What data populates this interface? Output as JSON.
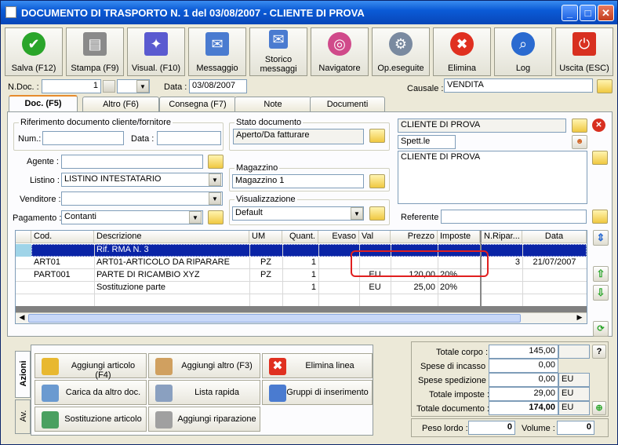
{
  "window": {
    "title": "DOCUMENTO DI TRASPORTO N. 1   del 03/08/2007 - CLIENTE DI PROVA"
  },
  "toolbar": [
    {
      "label": "Salva (F12)",
      "icon": "check-icon",
      "color": "#2aa52a"
    },
    {
      "label": "Stampa (F9)",
      "icon": "printer-icon",
      "color": "#8a8a8a"
    },
    {
      "label": "Visual. (F10)",
      "icon": "magic-wand-icon",
      "color": "#5a5ad0"
    },
    {
      "label": "Messaggio",
      "icon": "envelope-pen-icon",
      "color": "#4a7bd0"
    },
    {
      "label": "Storico messaggi",
      "icon": "search-mail-icon",
      "color": "#4a7bd0"
    },
    {
      "label": "Navigatore",
      "icon": "compass-icon",
      "color": "#d04a8a"
    },
    {
      "label": "Op.eseguite",
      "icon": "gears-icon",
      "color": "#7a8aa0"
    },
    {
      "label": "Elimina",
      "icon": "delete-x-icon",
      "color": "#e03020"
    },
    {
      "label": "Log",
      "icon": "magnifier-book-icon",
      "color": "#2a6ad0"
    },
    {
      "label": "Uscita (ESC)",
      "icon": "exit-icon",
      "color": "#d83020"
    }
  ],
  "header": {
    "ndoc_label": "N.Doc. :",
    "ndoc_value": "1",
    "data_label": "Data :",
    "data_value": "03/08/2007",
    "causale_label": "Causale :",
    "causale_value": "VENDITA"
  },
  "tabs": [
    "Doc. (F5)",
    "Altro (F6)",
    "Consegna (F7)",
    "Note",
    "Documenti"
  ],
  "doc": {
    "rif_title": "Riferimento documento cliente/fornitore",
    "num_label": "Num.:",
    "data_label": "Data :",
    "stato_title": "Stato documento",
    "stato_value": "Aperto/Da fatturare",
    "agente_label": "Agente :",
    "listino_label": "Listino :",
    "listino_value": "LISTINO INTESTATARIO",
    "venditore_label": "Venditore :",
    "pagamento_label": "Pagamento :",
    "pagamento_value": "Contanti",
    "magazzino_title": "Magazzino",
    "magazzino_value": "Magazzino 1",
    "visual_title": "Visualizzazione",
    "visual_value": "Default",
    "cliente_name": "CLIENTE DI PROVA",
    "cliente_prefix": "Spett.le",
    "cliente_address": "CLIENTE DI PROVA",
    "referente_label": "Referente"
  },
  "grid": {
    "columns": [
      "Cod.",
      "Descrizione",
      "UM",
      "Quant.",
      "Evaso",
      "Val",
      "Prezzo",
      "Imposte",
      "N.Ripar...",
      "Data"
    ],
    "rows": [
      {
        "cod": "",
        "desc": "Rif. RMA N. 3",
        "um": "",
        "qty": "",
        "evaso": "",
        "val": "",
        "prezzo": "",
        "imposte": "",
        "nrip": "",
        "data": ""
      },
      {
        "cod": "ART01",
        "desc": "ART01-ARTICOLO DA RIPARARE",
        "um": "PZ",
        "qty": "1",
        "evaso": "",
        "val": "",
        "prezzo": "",
        "imposte": "",
        "nrip": "3",
        "data": "21/07/2007"
      },
      {
        "cod": "PART001",
        "desc": "PARTE DI RICAMBIO XYZ",
        "um": "PZ",
        "qty": "1",
        "evaso": "",
        "val": "EU",
        "prezzo": "120,00",
        "imposte": "20%",
        "nrip": "",
        "data": ""
      },
      {
        "cod": "",
        "desc": "Sostituzione parte",
        "um": "",
        "qty": "1",
        "evaso": "",
        "val": "EU",
        "prezzo": "25,00",
        "imposte": "20%",
        "nrip": "",
        "data": ""
      }
    ]
  },
  "actions": {
    "side_tab1": "Azioni",
    "side_tab2": "Av.",
    "buttons": [
      "Aggiungi articolo (F4)",
      "Aggiungi altro (F3)",
      "Elimina linea",
      "Carica da altro doc.",
      "Lista rapida",
      "Gruppi di inserimento",
      "Sostituzione articolo",
      "Aggiungi riparazione"
    ]
  },
  "totals": [
    {
      "label": "Totale corpo :",
      "value": "145,00",
      "unit": ""
    },
    {
      "label": "Spese di incasso :",
      "value": "0,00",
      "unit": ""
    },
    {
      "label": "Spese spedizione :",
      "value": "0,00",
      "unit": "EU"
    },
    {
      "label": "Totale imposte :",
      "value": "29,00",
      "unit": "EU"
    },
    {
      "label": "Totale documento :",
      "value": "174,00",
      "unit": "EU"
    }
  ],
  "peso": {
    "lordo_label": "Peso lordo :",
    "lordo_value": "0",
    "volume_label": "Volume :",
    "volume_value": "0"
  }
}
